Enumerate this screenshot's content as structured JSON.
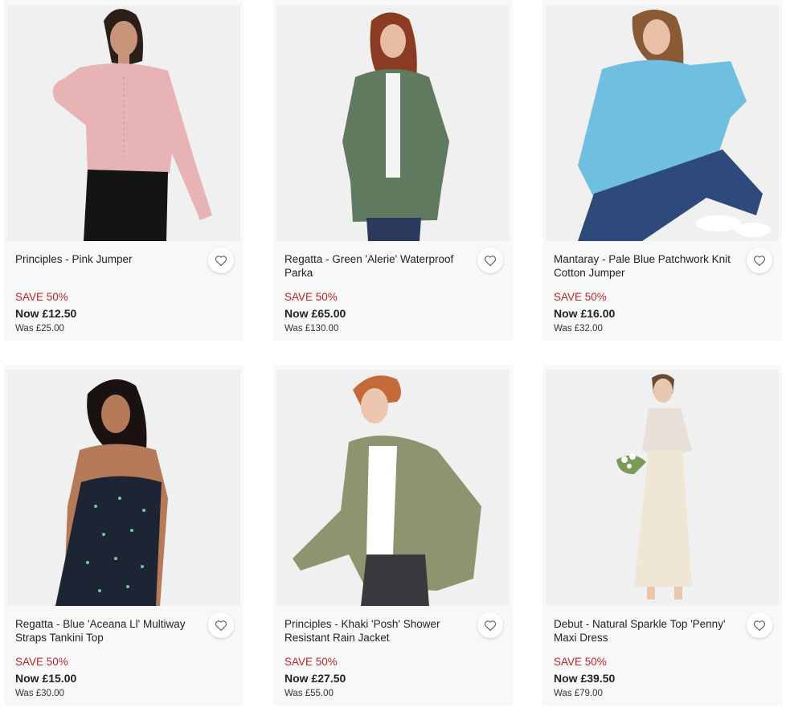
{
  "products": [
    {
      "name": "Principles - Pink Jumper",
      "save": "SAVE 50%",
      "now": "Now £12.50",
      "was": "Was £25.00",
      "image": "model-pink-jumper",
      "garment_color": "#e7b3b4",
      "favourite_icon": "heart-outline-icon"
    },
    {
      "name": "Regatta - Green 'Alerie' Waterproof Parka",
      "save": "SAVE 50%",
      "now": "Now £65.00",
      "was": "Was £130.00",
      "image": "model-green-parka",
      "garment_color": "#5f7a5e",
      "favourite_icon": "heart-outline-icon"
    },
    {
      "name": "Mantaray - Pale Blue Patchwork Knit Cotton Jumper",
      "save": "SAVE 50%",
      "now": "Now £16.00",
      "was": "Was £32.00",
      "image": "model-blue-jumper",
      "garment_color": "#6fc0e0",
      "favourite_icon": "heart-outline-icon"
    },
    {
      "name": "Regatta - Blue 'Aceana Ll' Multiway Straps Tankini Top",
      "save": "SAVE 50%",
      "now": "Now £15.00",
      "was": "Was £30.00",
      "image": "model-tankini-top",
      "garment_color": "#1d2433",
      "favourite_icon": "heart-outline-icon"
    },
    {
      "name": "Principles - Khaki 'Posh' Shower Resistant Rain Jacket",
      "save": "SAVE 50%",
      "now": "Now £27.50",
      "was": "Was £55.00",
      "image": "model-khaki-jacket",
      "garment_color": "#8f9470",
      "favourite_icon": "heart-outline-icon"
    },
    {
      "name": "Debut - Natural Sparkle Top 'Penny' Maxi Dress",
      "save": "SAVE 50%",
      "now": "Now £39.50",
      "was": "Was £79.00",
      "image": "model-maxi-dress",
      "garment_color": "#efe6d6",
      "favourite_icon": "heart-outline-icon"
    }
  ],
  "colors": {
    "save_red": "#b3262b",
    "card_background": "#f8f8f8"
  }
}
